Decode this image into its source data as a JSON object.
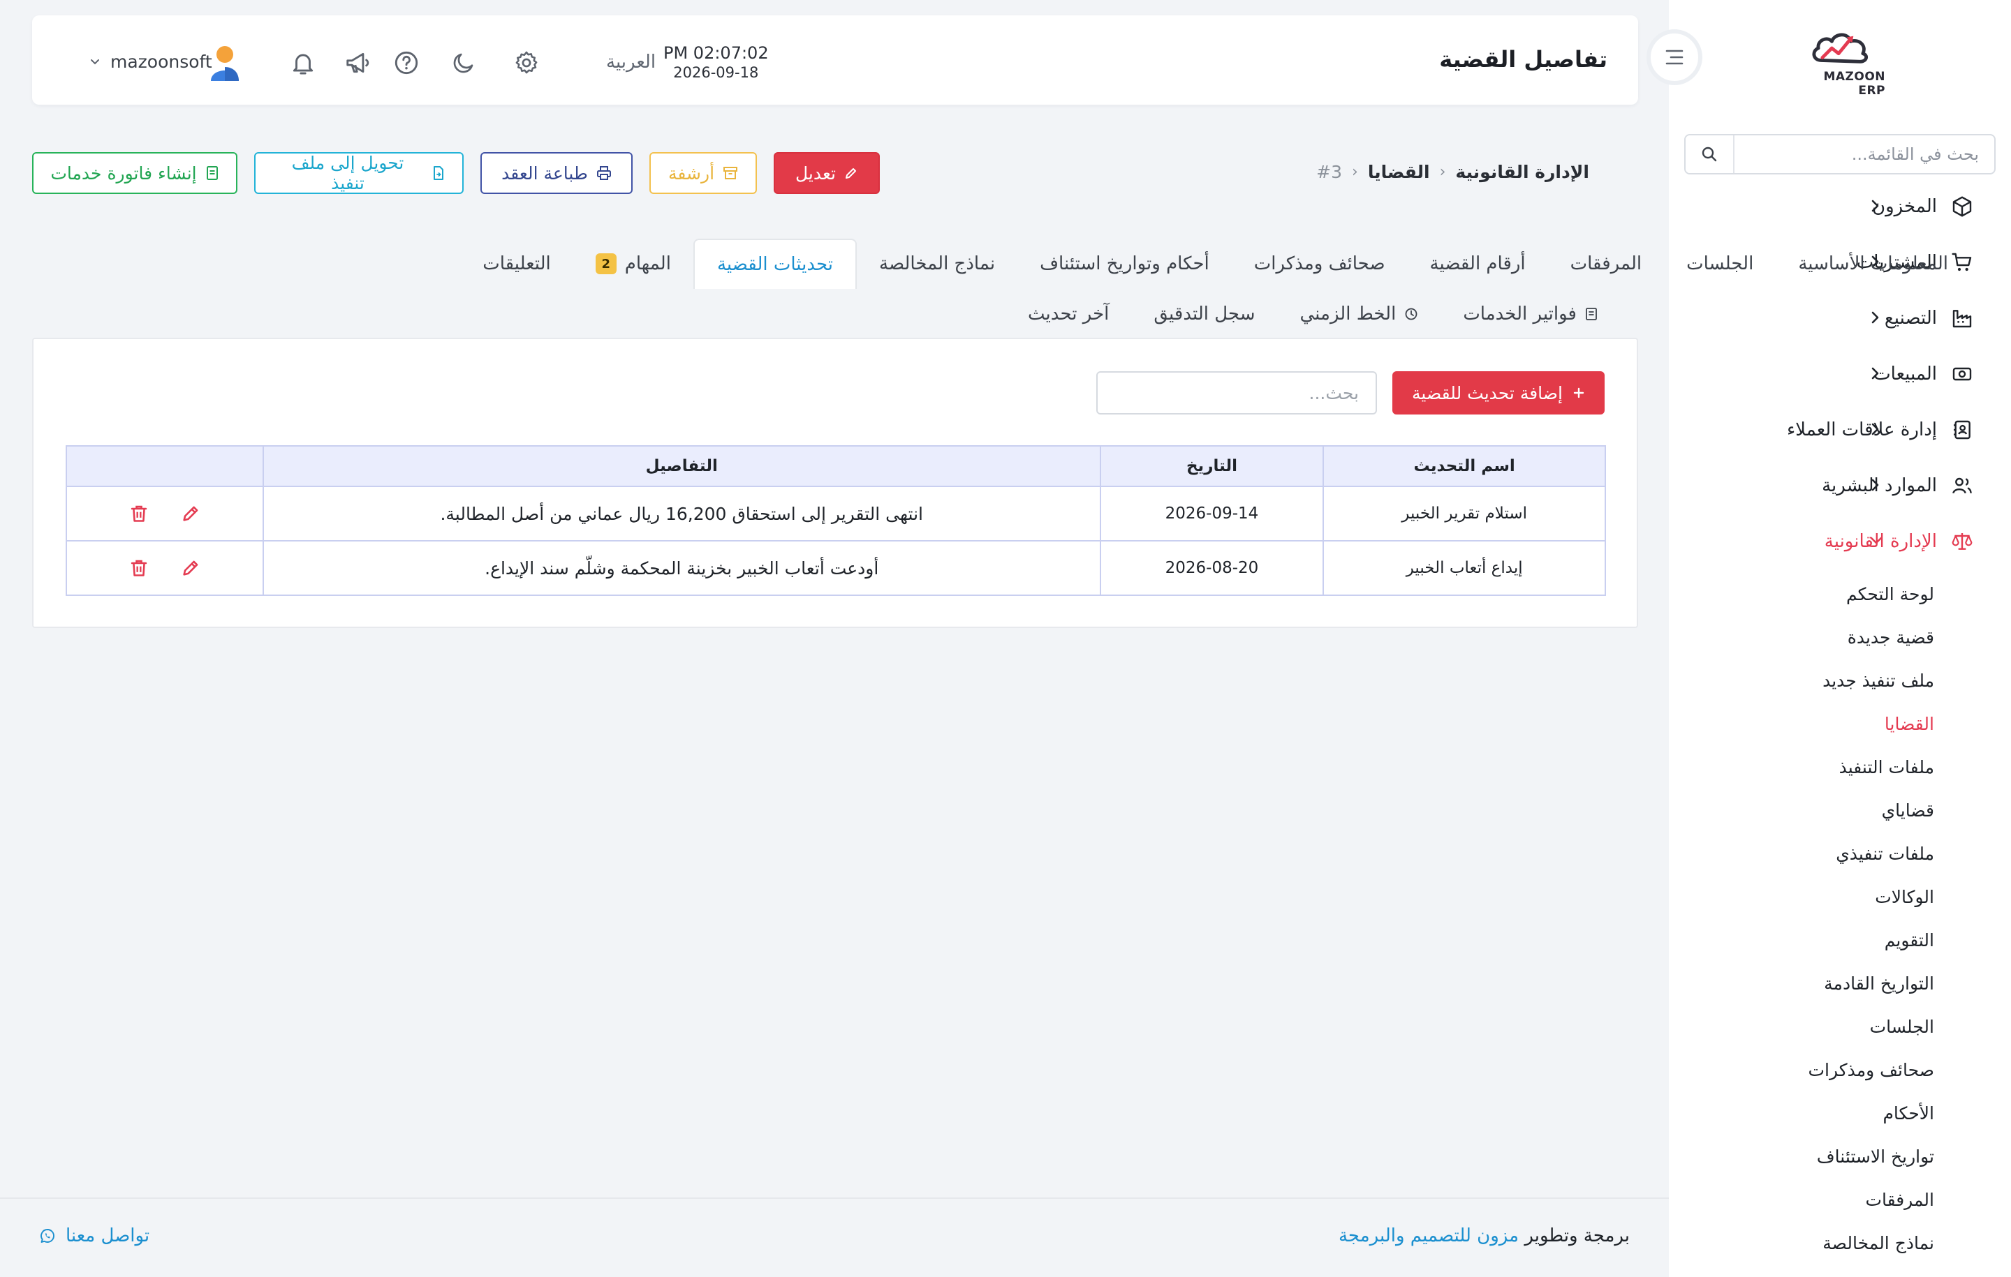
{
  "app": {
    "logo_text": "MAZOON ERP",
    "logo_subtext": "ERP مزون"
  },
  "sidebar": {
    "search_placeholder": "بحث في القائمة...",
    "items": [
      {
        "label": "المخزون",
        "icon": "box-icon"
      },
      {
        "label": "المشتريات",
        "icon": "cart-icon"
      },
      {
        "label": "التصنيع",
        "icon": "factory-icon"
      },
      {
        "label": "المبيعات",
        "icon": "cash-icon"
      },
      {
        "label": "إدارة علاقات العملاء",
        "icon": "contacts-icon"
      },
      {
        "label": "الموارد البشرية",
        "icon": "users-icon"
      },
      {
        "label": "الإدارة القانونية",
        "icon": "scale-icon"
      }
    ],
    "submenu": [
      "لوحة التحكم",
      "قضية جديدة",
      "ملف تنفيذ جديد",
      "القضايا",
      "ملفات التنفيذ",
      "قضاياي",
      "ملفات تنفيذي",
      "الوكالات",
      "التقويم",
      "التواريخ القادمة",
      "الجلسات",
      "صحائف ومذكرات",
      "الأحكام",
      "تواريخ الاستئناف",
      "المرفقات",
      "نماذج المخالصة"
    ],
    "active_submenu": "القضايا",
    "accent_color": "#e43b51"
  },
  "header": {
    "title": "تفاصيل القضية",
    "time": "PM 02:07:02",
    "date": "2026-09-18",
    "language": "العربية",
    "username": "mazoonsoft"
  },
  "breadcrumb": {
    "root": "الإدارة القانونية",
    "section": "القضايا",
    "id": "#3"
  },
  "actions": {
    "edit": "تعديل",
    "archive": "أرشفة",
    "print_contract": "طباعة العقد",
    "convert_to_execution": "تحويل إلى ملف تنفيذ",
    "create_service_invoice": "إنشاء فاتورة خدمات"
  },
  "tabs": {
    "row1": [
      "المعلومات الأساسية",
      "الجلسات",
      "المرفقات",
      "أرقام القضية",
      "صحائف ومذكرات",
      "أحكام وتواريخ استئناف",
      "نماذج المخالصة",
      "تحديثات القضية",
      "المهام",
      "التعليقات"
    ],
    "active": "تحديثات القضية",
    "tasks_badge": "2",
    "row2": [
      "فواتير الخدمات",
      "الخط الزمني",
      "سجل التدقيق",
      "آخر تحديث"
    ]
  },
  "updates": {
    "add_button": "إضافة تحديث للقضية",
    "search_placeholder": "بحث...",
    "columns": [
      "اسم التحديث",
      "التاريخ",
      "التفاصيل",
      ""
    ],
    "rows": [
      {
        "name": "استلام تقرير الخبير",
        "date": "2026-09-14",
        "details": "انتهى التقرير إلى استحقاق 16,200 ريال عماني من أصل المطالبة."
      },
      {
        "name": "إيداع أتعاب الخبير",
        "date": "2026-08-20",
        "details": "أودعت أتعاب الخبير بخزينة المحكمة وشلّم سند الإيداع."
      }
    ]
  },
  "footer": {
    "credit_prefix": "برمجة وتطوير",
    "credit_link": "مزون للتصميم والبرمجة",
    "contact": "تواصل معنا"
  }
}
